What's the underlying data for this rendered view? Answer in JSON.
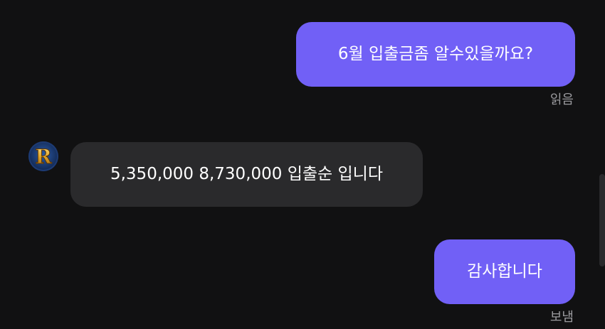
{
  "messages": [
    {
      "direction": "outgoing",
      "text": "6월 입출금좀 알수있을까요?",
      "status": "읽음"
    },
    {
      "direction": "incoming",
      "text": "5,350,000 8,730,000 입출순 입니다"
    },
    {
      "direction": "outgoing",
      "text": "감사합니다",
      "status": "보냄"
    }
  ],
  "avatar": {
    "letter": "R"
  },
  "colors": {
    "background": "#111112",
    "outgoing_bubble": "#7160f6",
    "incoming_bubble": "#2a2a2c",
    "status_text": "#9a9a9e"
  }
}
